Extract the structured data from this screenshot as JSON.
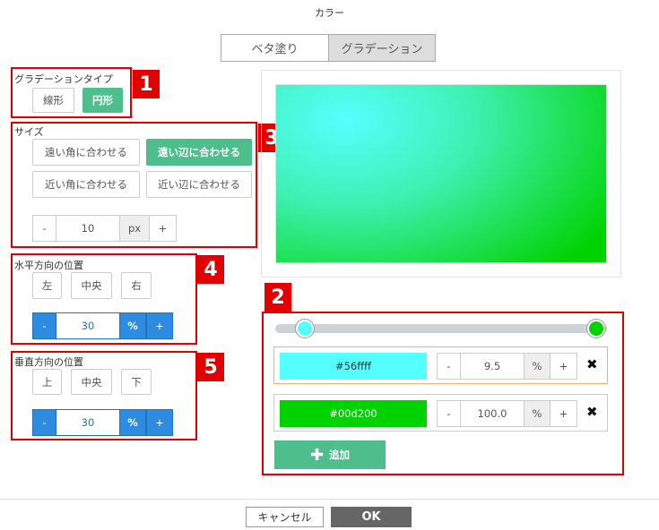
{
  "dialog": {
    "title": "カラー"
  },
  "mode_tabs": [
    {
      "label": "ベタ塗り",
      "active": false
    },
    {
      "label": "グラデーション",
      "active": true
    }
  ],
  "gradient_type": {
    "badge": "1",
    "label": "グラデーションタイプ",
    "options": [
      {
        "label": "線形",
        "selected": false
      },
      {
        "label": "円形",
        "selected": true
      }
    ]
  },
  "size": {
    "badge": "3",
    "label": "サイズ",
    "options": [
      {
        "label": "遠い角に合わせる",
        "selected": false
      },
      {
        "label": "遠い辺に合わせる",
        "selected": true
      },
      {
        "label": "近い角に合わせる",
        "selected": false
      },
      {
        "label": "近い辺に合わせる",
        "selected": false
      }
    ],
    "stepper": {
      "minus": "-",
      "value": "10",
      "unit": "px",
      "plus": "+"
    }
  },
  "horizontal": {
    "badge": "4",
    "label": "水平方向の位置",
    "options": [
      {
        "label": "左"
      },
      {
        "label": "中央"
      },
      {
        "label": "右"
      }
    ],
    "stepper": {
      "minus": "-",
      "value": "30",
      "unit": "%",
      "plus": "+"
    }
  },
  "vertical": {
    "badge": "5",
    "label": "垂直方向の位置",
    "options": [
      {
        "label": "上"
      },
      {
        "label": "中央"
      },
      {
        "label": "下"
      }
    ],
    "stepper": {
      "minus": "-",
      "value": "30",
      "unit": "%",
      "plus": "+"
    }
  },
  "stops": {
    "badge": "2",
    "slider": {
      "colors": [
        "#56ffff",
        "#00d200"
      ],
      "positions_percent": [
        9.5,
        100.0
      ]
    },
    "items": [
      {
        "color": "#56ffff",
        "text_color": "#333333",
        "minus": "-",
        "value": "9.5",
        "unit": "%",
        "plus": "+",
        "selected": true
      },
      {
        "color": "#00d200",
        "text_color": "#ffffff",
        "minus": "-",
        "value": "100.0",
        "unit": "%",
        "plus": "+",
        "selected": false
      }
    ],
    "add_label": "追加"
  },
  "footer": {
    "cancel": "キャンセル",
    "ok": "OK"
  },
  "colors": {
    "accent_green": "#4dbe8c",
    "accent_blue": "#2d8ce0",
    "annotation_red": "#e00000"
  }
}
